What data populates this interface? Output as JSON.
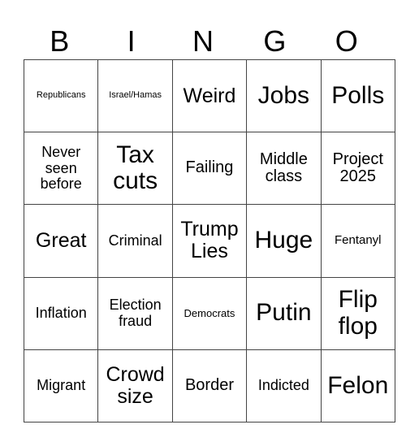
{
  "header": [
    "B",
    "I",
    "N",
    "G",
    "O"
  ],
  "rows": [
    [
      "Republicans",
      "Israel/Hamas",
      "Weird",
      "Jobs",
      "Polls"
    ],
    [
      "Never seen before",
      "Tax cuts",
      "Failing",
      "Middle class",
      "Project 2025"
    ],
    [
      "Great",
      "Criminal",
      "Trump Lies",
      "Huge",
      "Fentanyl"
    ],
    [
      "Inflation",
      "Election fraud",
      "Democrats",
      "Putin",
      "Flip flop"
    ],
    [
      "Migrant",
      "Crowd size",
      "Border",
      "Indicted",
      "Felon"
    ]
  ]
}
